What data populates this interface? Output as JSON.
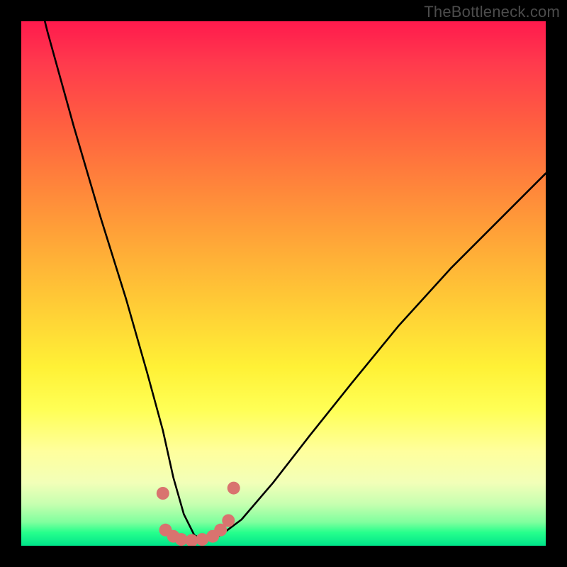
{
  "watermark": "TheBottleneck.com",
  "colors": {
    "frame": "#000000",
    "curve_stroke": "#000000",
    "marker_fill": "#d9736f",
    "gradient_top": "#ff1a4d",
    "gradient_bottom": "#00e58a"
  },
  "chart_data": {
    "type": "line",
    "title": "",
    "xlabel": "",
    "ylabel": "",
    "xlim": [
      0,
      100
    ],
    "ylim": [
      0,
      100
    ],
    "grid": false,
    "note": "Interpretation: x≈relative hardware capability; y≈estimated bottleneck percentage. Background hue encodes severity (red→high, green→low). No axis tick labels are printed in the source image; numeric values below are estimated from curve geometry.",
    "series": [
      {
        "name": "bottleneck-curve",
        "x": [
          0,
          5,
          10,
          15,
          20,
          24,
          27,
          29,
          31,
          33,
          35,
          38,
          42,
          48,
          55,
          63,
          72,
          82,
          92,
          100
        ],
        "y": [
          118,
          98,
          80,
          63,
          47,
          33,
          22,
          13,
          6,
          2,
          1,
          2,
          5,
          12,
          21,
          31,
          42,
          53,
          63,
          71
        ]
      }
    ],
    "markers": {
      "name": "highlight-dots",
      "x": [
        27.5,
        29.0,
        30.5,
        32.5,
        34.5,
        36.5,
        38.0,
        39.5,
        27.0,
        40.5
      ],
      "y": [
        3.0,
        1.8,
        1.2,
        1.0,
        1.2,
        1.8,
        3.0,
        4.8,
        10.0,
        11.0
      ],
      "r": 9
    }
  }
}
